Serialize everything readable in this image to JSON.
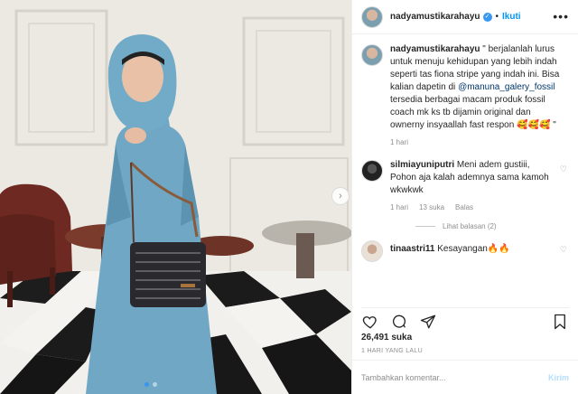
{
  "author": {
    "username": "nadyamustikarahayu",
    "separator": "•",
    "follow_label": "Ikuti",
    "more_label": "•••"
  },
  "caption": {
    "username": "nadyamustikarahayu",
    "text_before": "\" berjalanlah lurus untuk menuju kehidupan yang lebih indah seperti tas fiona stripe yang indah ini. Bisa kalian dapetin di ",
    "mention": "@manuna_galery_fossil",
    "text_after": " tersedia berbagai macam produk fossil coach mk ks tb dijamin original dan ownerny insyaallah fast respon 🥰🥰🥰 \"",
    "time": "1 hari"
  },
  "comments": [
    {
      "username": "silmiayuniputri",
      "text": "Meni adem gustiii, Pohon aja kalah ademnya sama kamoh wkwkwk",
      "time": "1 hari",
      "likes": "13 suka",
      "reply": "Balas",
      "view_replies": "Lihat balasan (2)"
    },
    {
      "username": "tinaastri11",
      "text": "Kesayangan🔥🔥"
    }
  ],
  "stats": {
    "likes": "26,491 suka",
    "timestamp": "1 HARI YANG LALU"
  },
  "comment_box": {
    "placeholder": "Tambahkan komentar...",
    "post_label": "Kirim"
  },
  "icons": {
    "verified": "✓",
    "next": "›",
    "heart_small": "♡",
    "like": "heart-icon",
    "comment": "comment-icon",
    "share": "share-icon",
    "save": "bookmark-icon"
  }
}
